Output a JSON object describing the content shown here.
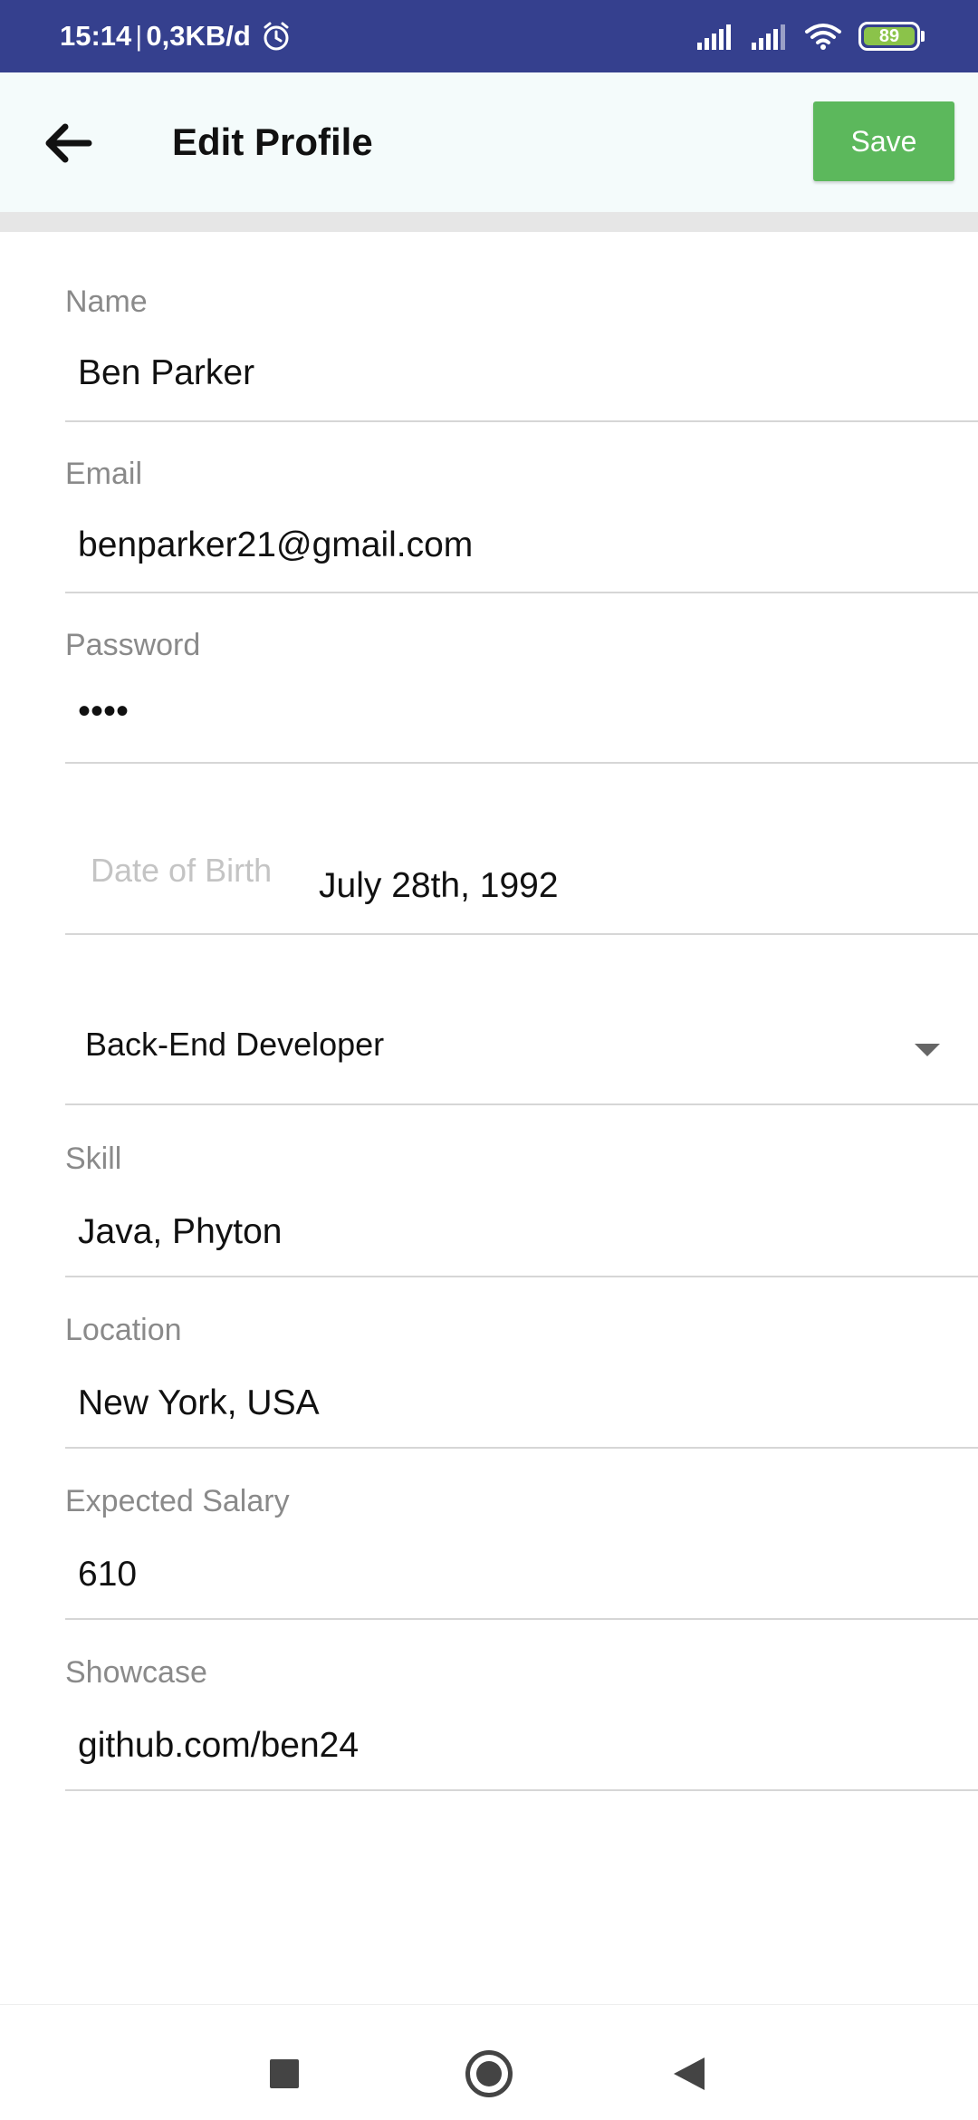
{
  "status_bar": {
    "time": "15:14",
    "separator": "|",
    "data_rate": "0,3KB/d",
    "battery_level": "89",
    "icons": [
      "alarm-icon",
      "signal-icon",
      "signal-icon",
      "wifi-icon",
      "battery-icon"
    ]
  },
  "app_bar": {
    "title": "Edit Profile",
    "save_label": "Save",
    "back_icon": "arrow-left-icon",
    "save_color": "#5cb85c",
    "background": "#f4fbfb"
  },
  "form": {
    "name": {
      "label": "Name",
      "value": "Ben Parker"
    },
    "email": {
      "label": "Email",
      "value": "benparker21@gmail.com"
    },
    "password": {
      "label": "Password",
      "value": "••••"
    },
    "dob": {
      "label": "Date of Birth",
      "value": "July 28th, 1992"
    },
    "role": {
      "value": "Back-End Developer"
    },
    "skill": {
      "label": "Skill",
      "value": "Java, Phyton"
    },
    "location": {
      "label": "Location",
      "value": "New York, USA"
    },
    "salary": {
      "label": "Expected Salary",
      "value": "610"
    },
    "showcase": {
      "label": "Showcase",
      "value": "github.com/ben24"
    }
  },
  "colors": {
    "status_bar": "#35408e",
    "battery": "#8bc34a"
  }
}
